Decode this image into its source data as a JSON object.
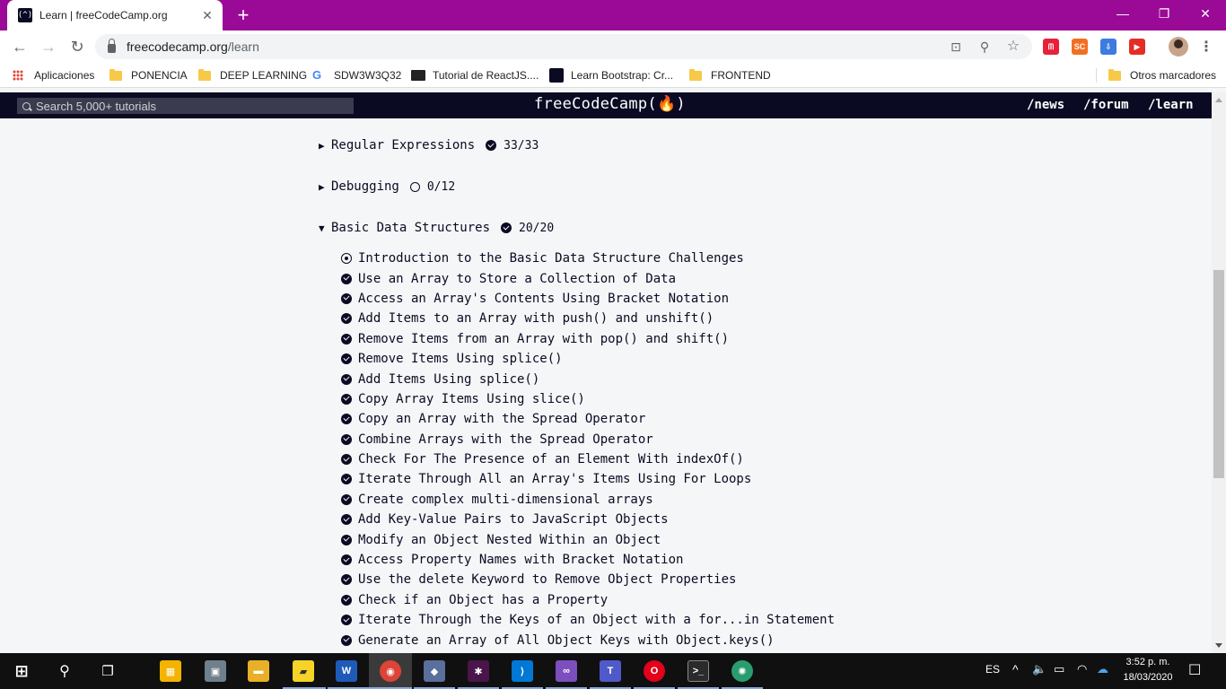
{
  "browser": {
    "tab_title": "Learn | freeCodeCamp.org",
    "tab_favicon": "(^)",
    "tab_close": "✕",
    "new_tab": "+",
    "window_controls": {
      "minimize": "—",
      "restore": "❐",
      "close": "✕"
    },
    "url_host": "freecodecamp.org",
    "url_path": "/learn",
    "nav": {
      "back": "←",
      "forward": "→",
      "reload": "↻"
    },
    "omnibox_icons": {
      "translate": "⊡",
      "zoom": "⚲",
      "star": "☆"
    },
    "extensions": [
      {
        "label": "ᗰ",
        "color": "#e8203a"
      },
      {
        "label": "SC",
        "color": "#f26f21"
      },
      {
        "label": "⇩",
        "color": "#3d7be0"
      },
      {
        "label": "▶",
        "color": "#e52d27"
      }
    ],
    "menu": "⋮"
  },
  "bookmarks": [
    {
      "label": "Aplicaciones",
      "icon": "apps-icon"
    },
    {
      "label": "PONENCIA",
      "icon": "folder-icon"
    },
    {
      "label": "DEEP LEARNING",
      "icon": "folder-icon"
    },
    {
      "label": "SDW3W3Q32",
      "icon": "google-icon"
    },
    {
      "label": "Tutorial de ReactJS....",
      "icon": "page-icon"
    },
    {
      "label": "Learn Bootstrap: Cr...",
      "icon": "freecodecamp-icon"
    },
    {
      "label": "FRONTEND",
      "icon": "folder-icon"
    },
    {
      "label": "Otros marcadores",
      "icon": "folder-icon"
    }
  ],
  "fcc": {
    "search_placeholder": "Search 5,000+ tutorials",
    "logo": "freeCodeCamp(🔥)",
    "nav_links": [
      "/news",
      "/forum",
      "/learn"
    ]
  },
  "blocks": [
    {
      "arrow": "▶",
      "name": "Regular Expressions",
      "status": "check-icon",
      "count": "33/33"
    },
    {
      "arrow": "▶",
      "name": "Debugging",
      "status": "empty-circle-icon",
      "count": "0/12"
    },
    {
      "arrow": "▼",
      "name": "Basic Data Structures",
      "status": "check-icon",
      "count": "20/20"
    }
  ],
  "challenges": [
    {
      "title": "Introduction to the Basic Data Structure Challenges",
      "status": "dot"
    },
    {
      "title": "Use an Array to Store a Collection of Data",
      "status": "check"
    },
    {
      "title": "Access an Array's Contents Using Bracket Notation",
      "status": "check"
    },
    {
      "title": "Add Items to an Array with push() and unshift()",
      "status": "check"
    },
    {
      "title": "Remove Items from an Array with pop() and shift()",
      "status": "check"
    },
    {
      "title": "Remove Items Using splice()",
      "status": "check"
    },
    {
      "title": "Add Items Using splice()",
      "status": "check"
    },
    {
      "title": "Copy Array Items Using slice()",
      "status": "check"
    },
    {
      "title": "Copy an Array with the Spread Operator",
      "status": "check"
    },
    {
      "title": "Combine Arrays with the Spread Operator",
      "status": "check"
    },
    {
      "title": "Check For The Presence of an Element With indexOf()",
      "status": "check"
    },
    {
      "title": "Iterate Through All an Array's Items Using For Loops",
      "status": "check"
    },
    {
      "title": "Create complex multi-dimensional arrays",
      "status": "check"
    },
    {
      "title": "Add Key-Value Pairs to JavaScript Objects",
      "status": "check"
    },
    {
      "title": "Modify an Object Nested Within an Object",
      "status": "check"
    },
    {
      "title": "Access Property Names with Bracket Notation",
      "status": "check"
    },
    {
      "title": "Use the delete Keyword to Remove Object Properties",
      "status": "check"
    },
    {
      "title": "Check if an Object has a Property",
      "status": "check"
    },
    {
      "title": "Iterate Through the Keys of an Object with a for...in Statement",
      "status": "check"
    },
    {
      "title": "Generate an Array of All Object Keys with Object.keys()",
      "status": "check"
    }
  ],
  "taskbar": {
    "apps": [
      {
        "name": "start-icon",
        "label": "⊞",
        "color": "transparent"
      },
      {
        "name": "search-icon",
        "label": "⚲",
        "color": "transparent"
      },
      {
        "name": "task-view-icon",
        "label": "❐",
        "color": "transparent"
      },
      {
        "name": "store-icon",
        "label": "▦",
        "color": "#f3b300"
      },
      {
        "name": "photos-icon",
        "label": "▣",
        "color": "#6e7f8d"
      },
      {
        "name": "file-explorer-icon",
        "label": "▬",
        "color": "#e8b028"
      },
      {
        "name": "sticky-notes-icon",
        "label": "▰",
        "color": "#f6d327"
      },
      {
        "name": "word-icon",
        "label": "W",
        "color": "#1e5bb8"
      },
      {
        "name": "chrome-icon",
        "label": "◉",
        "color": "#db4437"
      },
      {
        "name": "git-icon",
        "label": "◆",
        "color": "#5a6f9c"
      },
      {
        "name": "slack-icon",
        "label": "✱",
        "color": "#4a154b"
      },
      {
        "name": "vscode-icon",
        "label": "⟩",
        "color": "#0078d4"
      },
      {
        "name": "visual-studio-icon",
        "label": "∞",
        "color": "#7b4fbd"
      },
      {
        "name": "teams-icon",
        "label": "T",
        "color": "#5059c9"
      },
      {
        "name": "opera-icon",
        "label": "O",
        "color": "#e3001b"
      },
      {
        "name": "terminal-icon",
        "label": ">_",
        "color": "#2b2b2b"
      },
      {
        "name": "electron-icon",
        "label": "✺",
        "color": "#2a9d6f"
      }
    ],
    "language": "ES",
    "time": "3:52 p. m.",
    "date": "18/03/2020",
    "notifications": "☐"
  }
}
